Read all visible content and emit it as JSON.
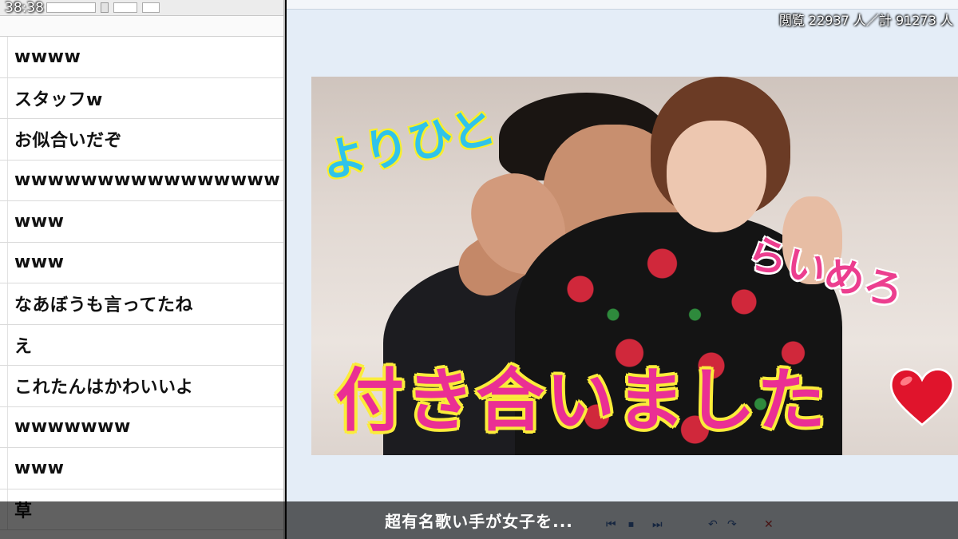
{
  "overlay": {
    "clock": "38:38",
    "view_stats": "閲覧 22937 人／計 91273 人",
    "subtitle": "超有名歌い手が女子を..."
  },
  "comments": [
    "wwww",
    "スタッフw",
    "お似合いだぞ",
    "wwwwwwwwwwwwwwww",
    "www",
    "www",
    "なあぼうも言ってたね",
    "え",
    "これたんはかわいいよ",
    "wwwwwww",
    "www",
    "草"
  ],
  "thumbnail": {
    "name_left": "よりひと",
    "name_right": "らいめろ",
    "headline": "付き合いました"
  },
  "colors": {
    "name_left": "#2fc3ea",
    "name_right": "#ec3e8f",
    "headline": "#ea2f94",
    "heart": "#e0142c"
  }
}
